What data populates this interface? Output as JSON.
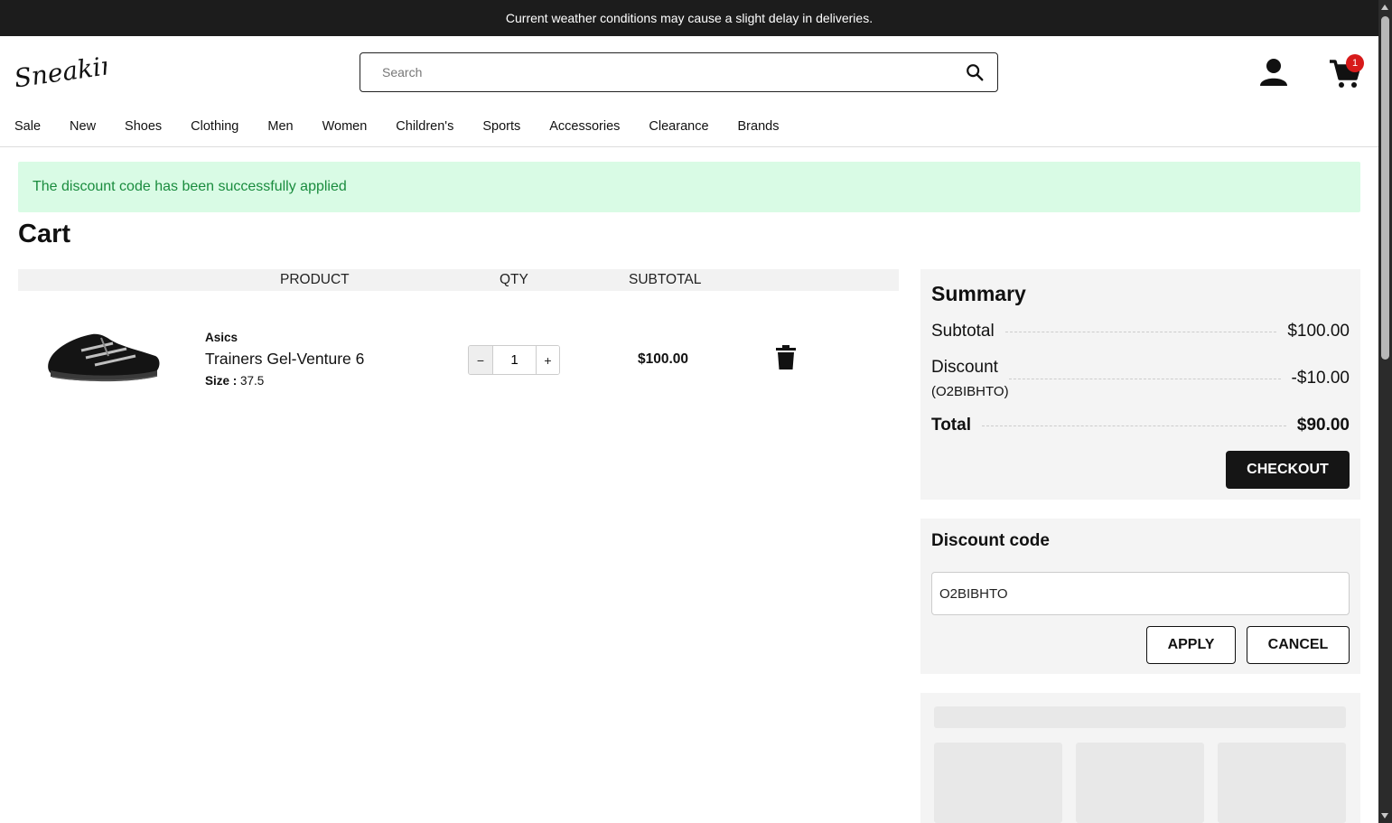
{
  "banner": {
    "text": "Current weather conditions may cause a slight delay in deliveries."
  },
  "header": {
    "logo": "Sneakin",
    "search": {
      "placeholder": "Search",
      "value": ""
    },
    "cart_count": "1"
  },
  "nav": [
    "Sale",
    "New",
    "Shoes",
    "Clothing",
    "Men",
    "Women",
    "Children's",
    "Sports",
    "Accessories",
    "Clearance",
    "Brands"
  ],
  "alert": {
    "text": "The discount code has been successfully applied",
    "color": "#1a8c3e",
    "background": "#d9fbe5"
  },
  "page_title": "Cart",
  "cart_table": {
    "headers": {
      "product": "PRODUCT",
      "qty": "QTY",
      "subtotal": "SUBTOTAL"
    },
    "items": [
      {
        "brand": "Asics",
        "name": "Trainers Gel-Venture 6",
        "size_label": "Size :",
        "size": "37.5",
        "qty": "1",
        "subtotal": "$100.00"
      }
    ]
  },
  "summary": {
    "title": "Summary",
    "subtotal_label": "Subtotal",
    "subtotal": "$100.00",
    "discount_label": "Discount",
    "discount_code": "(O2BIBHTO)",
    "discount": "-$10.00",
    "total_label": "Total",
    "total": "$90.00",
    "checkout_label": "CHECKOUT"
  },
  "discount_panel": {
    "title": "Discount code",
    "code_value": "O2BIBHTO",
    "apply_label": "APPLY",
    "cancel_label": "CANCEL"
  }
}
